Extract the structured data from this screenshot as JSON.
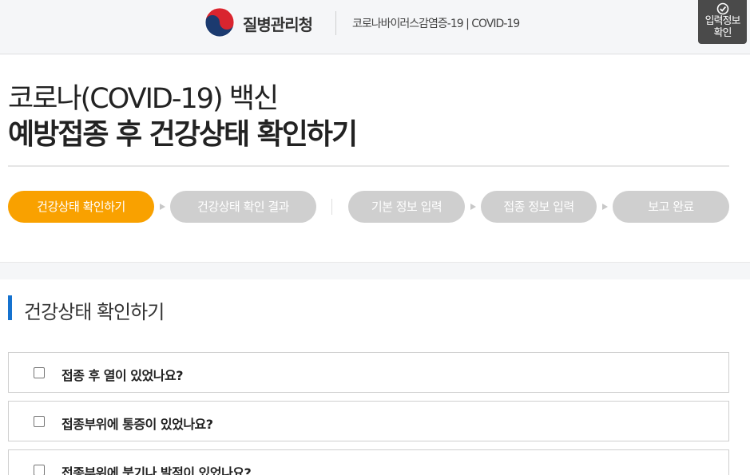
{
  "header": {
    "agency_name": "질병관리청",
    "subtitle": "코로나바이러스감염증-19 | COVID-19",
    "confirm_button": {
      "line1": "입력정보",
      "line2": "확인"
    }
  },
  "intro": {
    "title_line1": "코로나(COVID-19) 백신",
    "title_line2": "예방접종 후 건강상태 확인하기"
  },
  "steps": [
    {
      "label": "건강상태 확인하기",
      "active": true
    },
    {
      "label": "건강상태 확인 결과",
      "active": false
    },
    {
      "label": "기본 정보 입력",
      "active": false
    },
    {
      "label": "접종 정보 입력",
      "active": false
    },
    {
      "label": "보고 완료",
      "active": false
    }
  ],
  "section": {
    "title": "건강상태 확인하기"
  },
  "questions": [
    {
      "text": "접종 후 열이 있었나요?",
      "checked": false
    },
    {
      "text": "접종부위에 통증이 있었나요?",
      "checked": false
    },
    {
      "text": "접종부위에 붓기나 발적이 있었나요?",
      "checked": false
    }
  ],
  "colors": {
    "accent": "#f9a100",
    "inactive_step": "#cfcfcf",
    "section_bar": "#1572cf",
    "confirm_bg": "#4a4a4a"
  }
}
